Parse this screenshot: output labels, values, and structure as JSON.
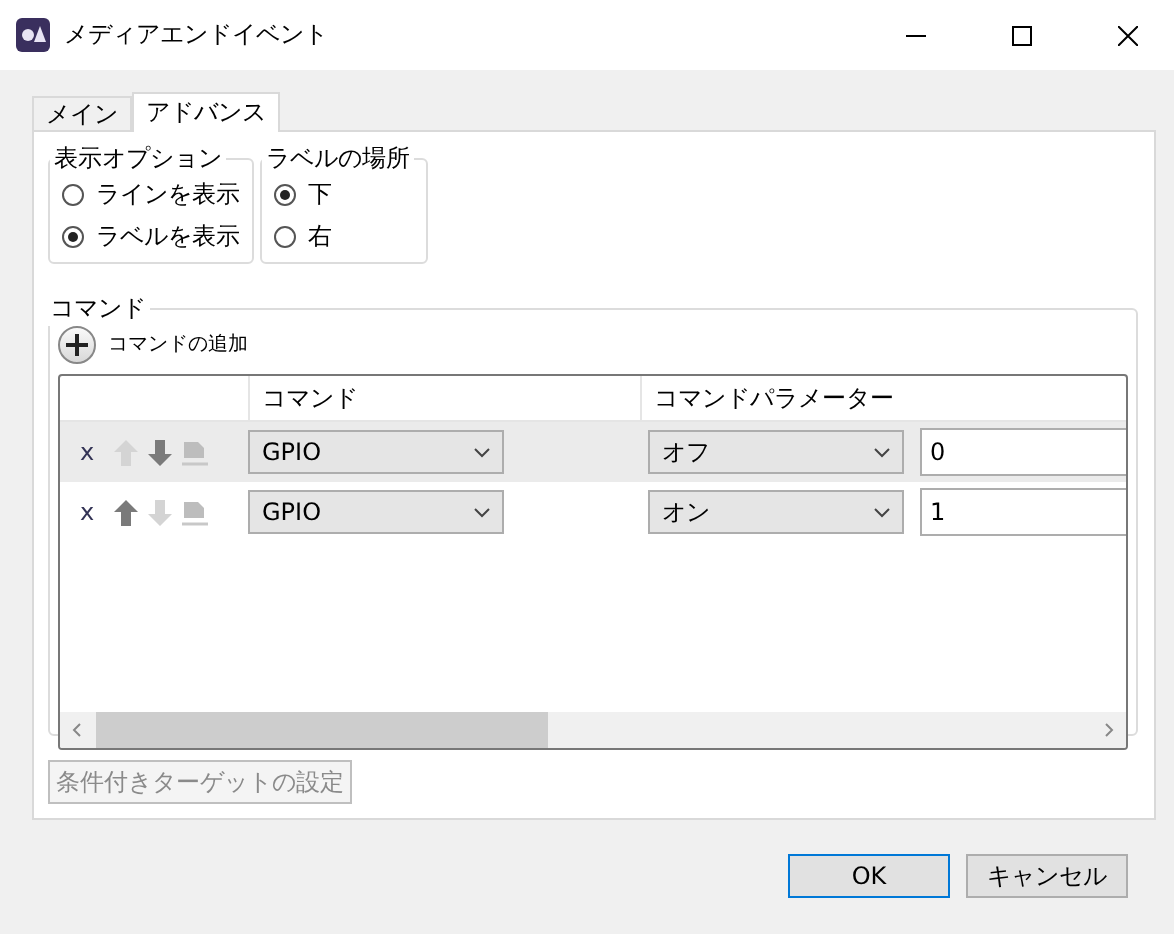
{
  "window": {
    "title": "メディアエンドイベント"
  },
  "tabs": [
    {
      "label": "メイン",
      "selected": false
    },
    {
      "label": "アドバンス",
      "selected": true
    }
  ],
  "display_options": {
    "title": "表示オプション",
    "options": [
      {
        "label": "ラインを表示",
        "selected": false
      },
      {
        "label": "ラベルを表示",
        "selected": true
      }
    ]
  },
  "label_position": {
    "title": "ラベルの場所",
    "options": [
      {
        "label": "下",
        "selected": true
      },
      {
        "label": "右",
        "selected": false
      }
    ]
  },
  "commands": {
    "title": "コマンド",
    "add_label": "コマンドの追加",
    "columns": [
      "コマンド",
      "コマンドパラメーター"
    ],
    "rows": [
      {
        "remove": "x",
        "up_enabled": false,
        "down_enabled": true,
        "command": "GPIO",
        "parameter": "オフ",
        "value": "0",
        "highlighted": true
      },
      {
        "remove": "x",
        "up_enabled": true,
        "down_enabled": false,
        "command": "GPIO",
        "parameter": "オン",
        "value": "1",
        "highlighted": false
      }
    ]
  },
  "conditional_button": {
    "label": "条件付きターゲットの設定",
    "disabled": true
  },
  "buttons": [
    {
      "label": "OK",
      "kind": "default"
    },
    {
      "label": "キャンセル",
      "kind": "normal"
    }
  ]
}
